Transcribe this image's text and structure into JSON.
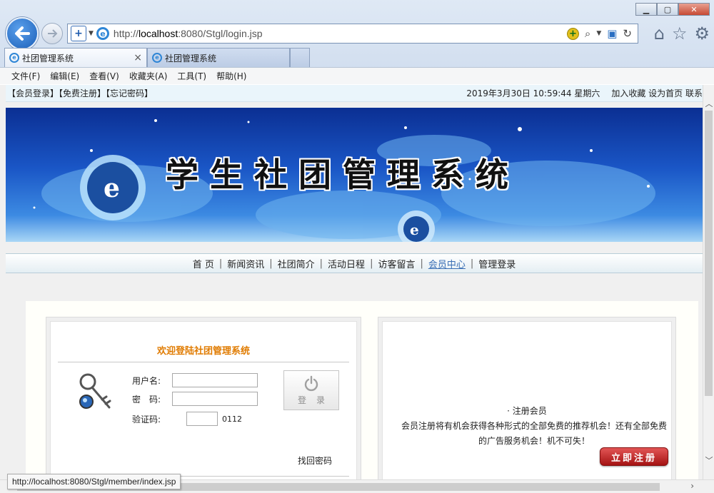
{
  "browser": {
    "url_prefix": "http://",
    "url_host": "localhost",
    "url_rest": ":8080/Stgl/login.jsp",
    "tabs": [
      {
        "title": "社团管理系统",
        "active": true
      },
      {
        "title": "社团管理系统",
        "active": false
      }
    ],
    "menu": [
      "文件(F)",
      "编辑(E)",
      "查看(V)",
      "收藏夹(A)",
      "工具(T)",
      "帮助(H)"
    ],
    "status_url": "http://localhost:8080/Stgl/member/index.jsp"
  },
  "topbar": {
    "links": "【会员登录】【免费注册】【忘记密码】",
    "date": "2019年3月30日 10:59:44  星期六",
    "right_links": "加入收藏 设为首页 联系"
  },
  "banner": {
    "title": "学生社团管理系统"
  },
  "nav": {
    "items": [
      "首 页",
      "新闻资讯",
      "社团简介",
      "活动日程",
      "访客留言",
      "会员中心",
      "管理登录"
    ],
    "active_index": 5
  },
  "login": {
    "title": "欢迎登陆社团管理系统",
    "username_label": "用户名:",
    "password_label": "密　码:",
    "captcha_label": "验证码:",
    "username_value": "",
    "password_value": "",
    "captcha_value": "",
    "captcha_code": "0112",
    "button_label": "登录",
    "forgot_link": "找回密码"
  },
  "register": {
    "title": "· 注册会员",
    "description": "会员注册将有机会获得各种形式的全部免费的推荐机会！还有全部免费的广告服务机会！机不可失！",
    "button_label": "立即注册"
  },
  "colors": {
    "accent_orange": "#e07b00",
    "nav_active": "#3a6fb5",
    "register_red": "#c42020"
  }
}
